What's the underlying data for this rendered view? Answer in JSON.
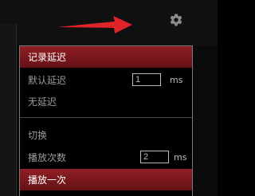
{
  "header": {
    "settings_icon": "gear-icon",
    "pointer_arrow_icon": "red-arrow-icon",
    "accent": "#e0242a"
  },
  "menu": {
    "record_delay": "记录延迟",
    "default_delay_label": "默认延迟",
    "default_delay_value": "1",
    "default_delay_unit": "ms",
    "no_delay": "无延迟",
    "toggle": "切换",
    "play_count_label": "播放次数",
    "play_count_value": "2",
    "play_count_unit": "ms",
    "play_once": "播放一次",
    "active_color": "#8f1f24"
  }
}
